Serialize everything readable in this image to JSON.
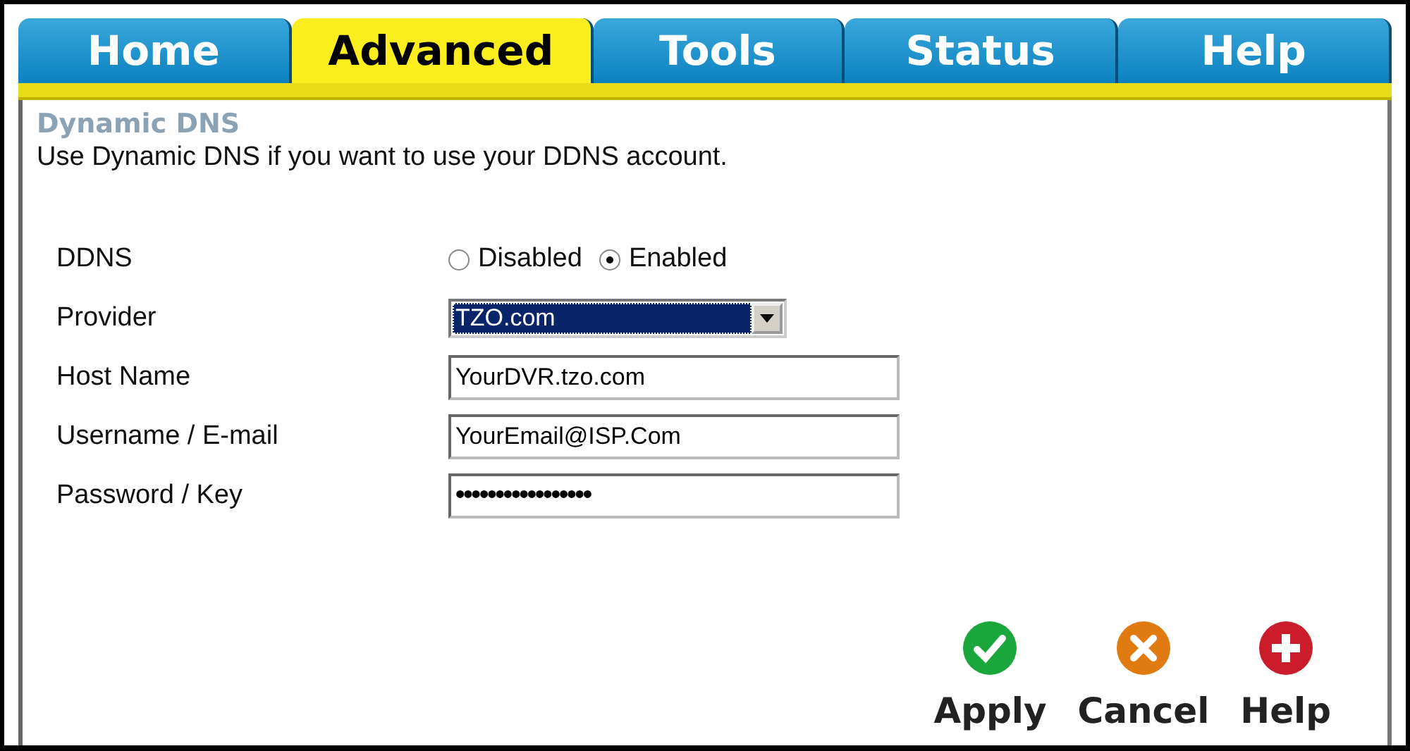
{
  "tabs": [
    {
      "label": "Home",
      "selected": false
    },
    {
      "label": "Advanced",
      "selected": true
    },
    {
      "label": "Tools",
      "selected": false
    },
    {
      "label": "Status",
      "selected": false
    },
    {
      "label": "Help",
      "selected": false
    }
  ],
  "section": {
    "title": "Dynamic DNS",
    "description": "Use Dynamic DNS if you want to use your DDNS account."
  },
  "fields": [
    {
      "kind": "radio",
      "label": "DDNS",
      "options": [
        {
          "label": "Disabled",
          "selected": false
        },
        {
          "label": "Enabled",
          "selected": true
        }
      ]
    },
    {
      "kind": "select",
      "label": "Provider",
      "value": "TZO.com"
    },
    {
      "kind": "text",
      "label": "Host Name",
      "value": "YourDVR.tzo.com"
    },
    {
      "kind": "text",
      "label": "Username / E-mail",
      "value": "YourEmail@ISP.Com"
    },
    {
      "kind": "password",
      "label": "Password / Key",
      "value": "•••••••••••••••••"
    }
  ],
  "buttons": [
    {
      "kind": "apply",
      "label": "Apply"
    },
    {
      "kind": "cancel",
      "label": "Cancel"
    },
    {
      "kind": "help",
      "label": "Help"
    }
  ]
}
